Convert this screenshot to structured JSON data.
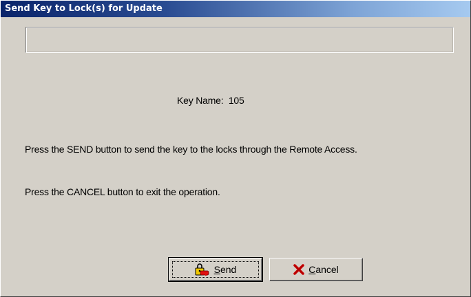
{
  "window": {
    "title": "Send Key to Lock(s) for Update"
  },
  "status_field": {
    "value": ""
  },
  "key": {
    "label": "Key Name:",
    "value": "105"
  },
  "instructions": {
    "send": "Press the SEND button to send the key to the locks through the Remote Access.",
    "cancel": "Press the CANCEL button to exit the operation."
  },
  "buttons": {
    "send": {
      "mnemonic": "S",
      "rest": "end",
      "icon": "key-lock-icon"
    },
    "cancel": {
      "mnemonic": "C",
      "rest": "ancel",
      "icon": "red-x-icon"
    }
  },
  "colors": {
    "title_bar_start": "#0a246a",
    "title_bar_end": "#a6caf0",
    "dialog_face": "#d4d0c8",
    "cancel_x": "#cc0000",
    "key_icon_yellow": "#f0c800"
  }
}
